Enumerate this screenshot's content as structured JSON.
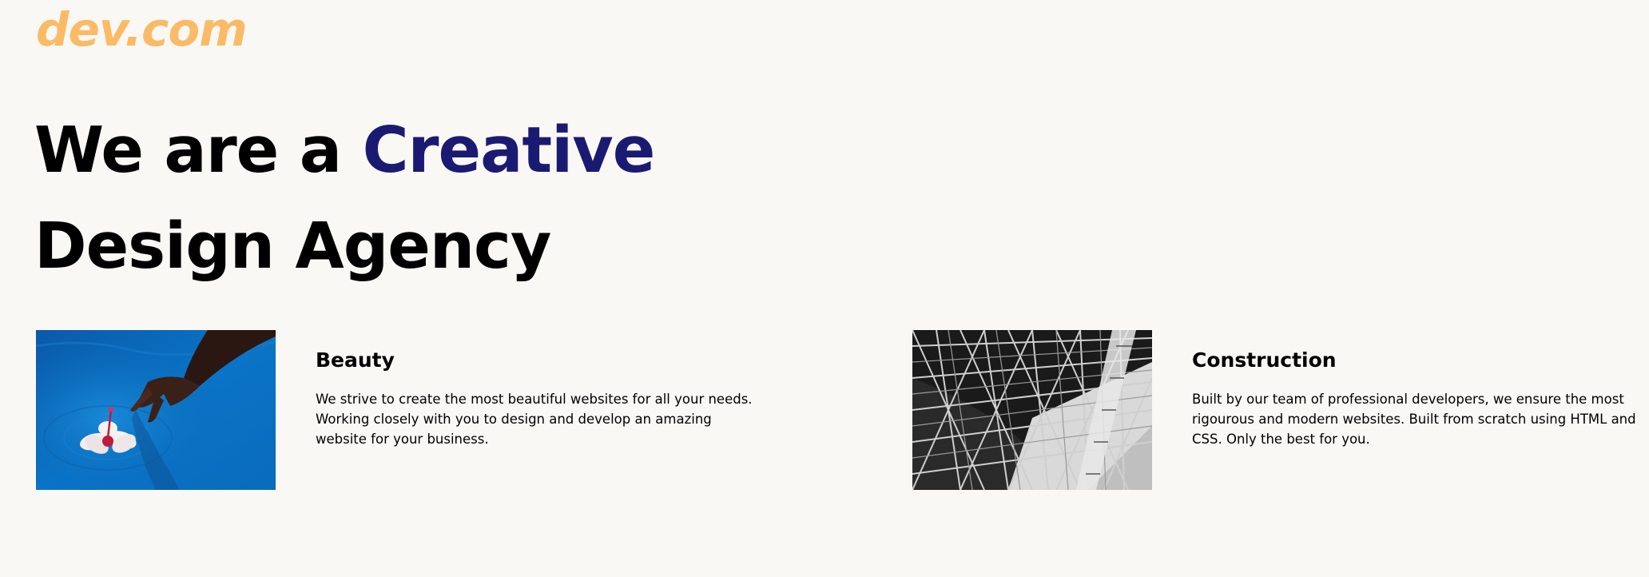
{
  "brand": {
    "logo_text": "dev.com",
    "logo_color": "#fbbb66"
  },
  "hero": {
    "prefix": "We are a ",
    "highlight": "Creative",
    "line2": "Design Agency",
    "highlight_color": "#1b1a72"
  },
  "cards": [
    {
      "image_icon": "hand-touching-flower-in-water-photo",
      "title": "Beauty",
      "text": "We strive to create the most beautiful websites for all your needs. Working closely with you to design and develop an amazing website for your business."
    },
    {
      "image_icon": "steel-truss-structure-photo",
      "title": "Construction",
      "text": "Built by our team of professional developers, we ensure the most rigourous and modern websites. Built from scratch using HTML and CSS. Only the best for you."
    }
  ]
}
